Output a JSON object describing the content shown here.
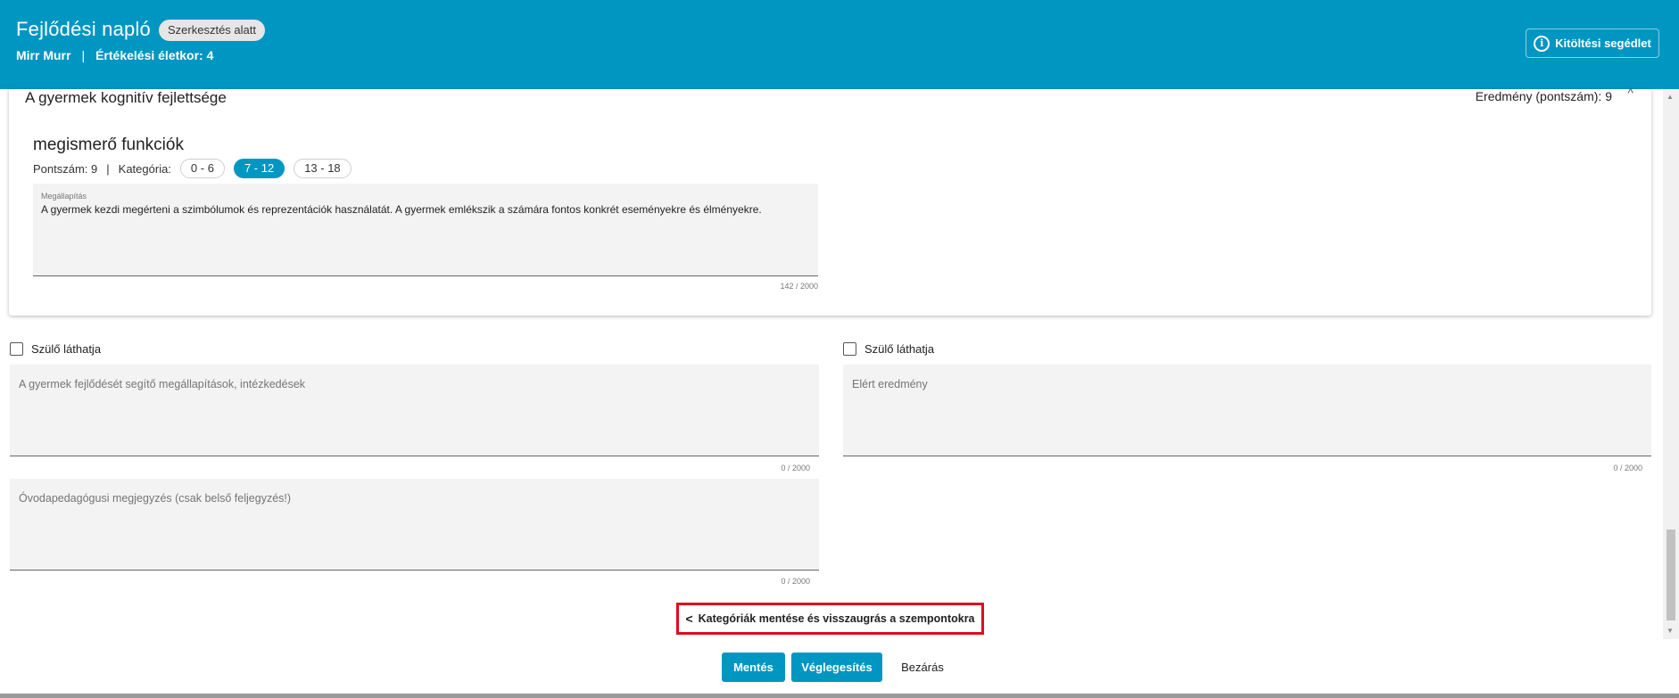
{
  "header": {
    "title": "Fejlődési napló",
    "badge": "Szerkesztés alatt",
    "child_name": "Mirr Murr",
    "separator": "|",
    "age_label": "Értékelési életkor: 4",
    "help_button": "Kitöltési segédlet",
    "info_glyph": "i"
  },
  "card": {
    "section_title": "A gyermek kognitív fejlettsége",
    "result": "Eredmény (pontszám): 9",
    "chevron": "^",
    "sub_title": "megismerő funkciók",
    "score": "Pontszám: 9",
    "separator": "|",
    "category_label": "Kategória:",
    "chips": [
      {
        "label": "0 - 6",
        "active": false
      },
      {
        "label": "7 - 12",
        "active": true
      },
      {
        "label": "13 - 18",
        "active": false
      }
    ],
    "finding_label": "Megállapítás",
    "finding_text": "A gyermek kezdi megérteni a szimbólumok és reprezentációk használatát. A gyermek emlékszik a számára fontos konkrét eseményekre és élményekre.",
    "finding_counter": "142 / 2000"
  },
  "left_column": {
    "checkbox_label": "Szülő láthatja",
    "measures_placeholder": "A gyermek fejlődését segítő megállapítások, intézkedések",
    "measures_counter": "0 / 2000",
    "note_placeholder": "Óvodapedagógusi megjegyzés (csak belső feljegyzés!)",
    "note_counter": "0 / 2000"
  },
  "right_column": {
    "checkbox_label": "Szülő láthatja",
    "result_placeholder": "Elért eredmény",
    "result_counter": "0 / 2000"
  },
  "actions": {
    "jump_chevron": "<",
    "jump_label": "Kategóriák mentése és visszaugrás a szempontokra",
    "save": "Mentés",
    "finalize": "Véglegesítés",
    "close": "Bezárás"
  },
  "scrollbar": {
    "up_glyph": "▲",
    "down_glyph": "▼"
  },
  "colors": {
    "header": "#0096c2",
    "accent": "#0096c2",
    "highlight": "#e00b1c"
  }
}
